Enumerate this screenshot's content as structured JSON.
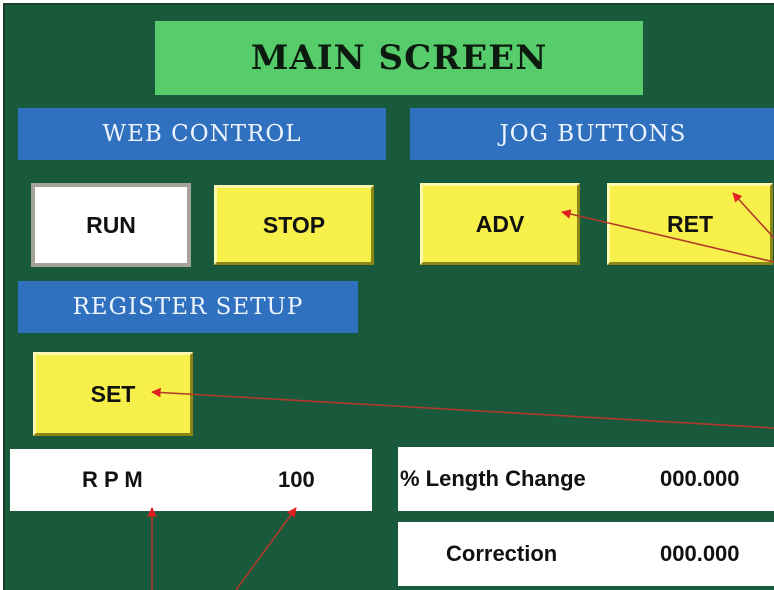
{
  "title": "MAIN SCREEN",
  "sections": {
    "web_control": "WEB CONTROL",
    "jog_buttons": "JOG  BUTTONS",
    "register_setup": "REGISTER SETUP"
  },
  "buttons": {
    "run": "RUN",
    "stop": "STOP",
    "adv": "ADV",
    "ret": "RET",
    "set": "SET"
  },
  "readouts": {
    "rpm_label": "R P M",
    "rpm_value": "100",
    "length_change_label": "% Length Change",
    "length_change_value": "000.000",
    "correction_label": "Correction",
    "correction_value": "000.000"
  },
  "colors": {
    "background": "#1a5a3c",
    "title_bar": "#56cc6a",
    "section_header": "#2f70bf",
    "button": "#f7ef4a",
    "run_button_active": "#ffffff",
    "annotation_arrow": "#e02020"
  }
}
